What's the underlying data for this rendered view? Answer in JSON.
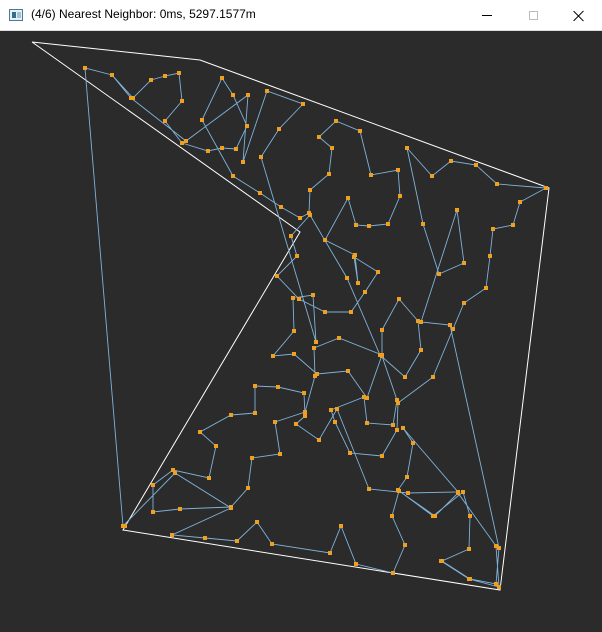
{
  "window": {
    "title": "(4/6) Nearest Neighbor: 0ms, 5297.1577m",
    "icon": "app-window-icon"
  },
  "controls": {
    "minimize_icon": "minimize-icon",
    "maximize_icon": "maximize-icon",
    "close_icon": "close-icon"
  },
  "colors": {
    "background": "#2b2b2b",
    "boundary": "#ffffff",
    "path": "#7fb3d9",
    "nodes": "#f0a020"
  }
}
